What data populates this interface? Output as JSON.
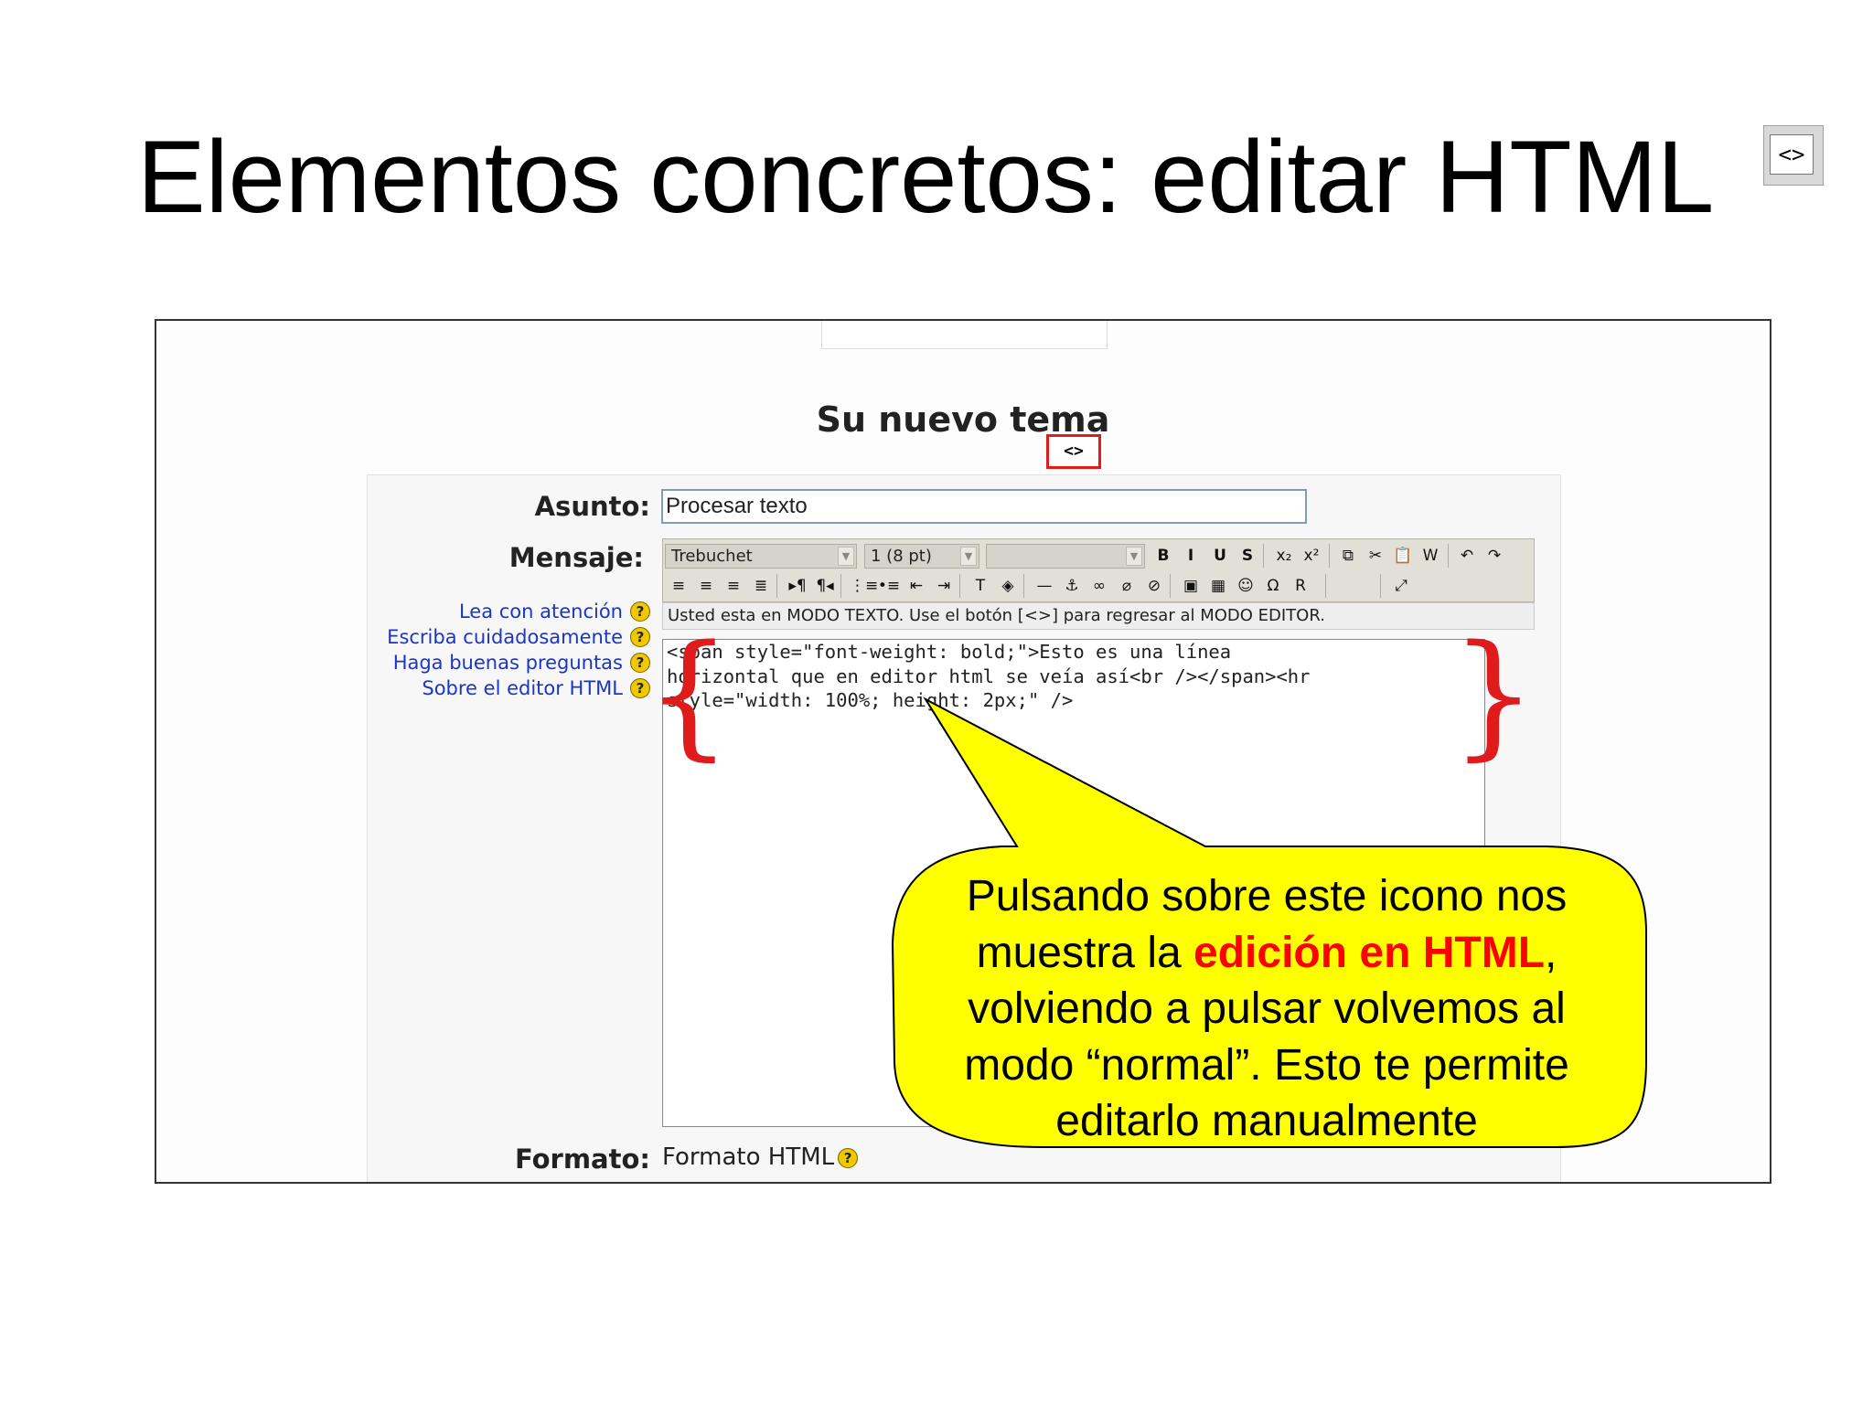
{
  "slide": {
    "title": "Elementos concretos: editar HTML",
    "title_icon": "<>"
  },
  "form": {
    "heading": "Su nuevo tema",
    "subject_label": "Asunto:",
    "subject_value": "Procesar texto",
    "message_label": "Mensaje:",
    "format_label": "Formato:",
    "format_value": "Formato HTML",
    "help_links": [
      {
        "label": "Lea con atención"
      },
      {
        "label": "Escriba cuidadosamente"
      },
      {
        "label": "Haga buenas preguntas"
      },
      {
        "label": "Sobre el editor HTML"
      }
    ]
  },
  "toolbar": {
    "font": "Trebuchet",
    "size": "1 (8 pt)",
    "style": "",
    "html_toggle": "<>",
    "row1": [
      {
        "name": "bold-button",
        "glyph": "B"
      },
      {
        "name": "italic-button",
        "glyph": "I"
      },
      {
        "name": "underline-button",
        "glyph": "U"
      },
      {
        "name": "strikethrough-button",
        "glyph": "S"
      },
      {
        "name": "subscript-button",
        "glyph": "x₂"
      },
      {
        "name": "superscript-button",
        "glyph": "x²"
      },
      {
        "name": "copy-button",
        "glyph": "⧉"
      },
      {
        "name": "cut-button",
        "glyph": "✂"
      },
      {
        "name": "paste-button",
        "glyph": "📋"
      },
      {
        "name": "paste-word-button",
        "glyph": "W"
      },
      {
        "name": "undo-button",
        "glyph": "↶"
      },
      {
        "name": "redo-button",
        "glyph": "↷"
      }
    ],
    "row2": [
      {
        "name": "align-left-button",
        "glyph": "≡"
      },
      {
        "name": "align-center-button",
        "glyph": "≡"
      },
      {
        "name": "align-right-button",
        "glyph": "≡"
      },
      {
        "name": "justify-button",
        "glyph": "≣"
      },
      {
        "name": "ltr-button",
        "glyph": "▸¶"
      },
      {
        "name": "rtl-button",
        "glyph": "¶◂"
      },
      {
        "name": "ordered-list-button",
        "glyph": "⋮≡"
      },
      {
        "name": "unordered-list-button",
        "glyph": "•≡"
      },
      {
        "name": "outdent-button",
        "glyph": "⇤"
      },
      {
        "name": "indent-button",
        "glyph": "⇥"
      },
      {
        "name": "text-color-button",
        "glyph": "T"
      },
      {
        "name": "background-color-button",
        "glyph": "◈"
      },
      {
        "name": "horizontal-rule-button",
        "glyph": "—"
      },
      {
        "name": "anchor-button",
        "glyph": "⚓"
      },
      {
        "name": "link-button",
        "glyph": "∞"
      },
      {
        "name": "unlink-button",
        "glyph": "⌀"
      },
      {
        "name": "nolink-button",
        "glyph": "⊘"
      },
      {
        "name": "image-button",
        "glyph": "▣"
      },
      {
        "name": "table-button",
        "glyph": "▦"
      },
      {
        "name": "smiley-button",
        "glyph": "☺"
      },
      {
        "name": "special-char-button",
        "glyph": "Ω"
      },
      {
        "name": "search-replace-button",
        "glyph": "R"
      },
      {
        "name": "fullscreen-button",
        "glyph": "⤢"
      }
    ]
  },
  "mode_bar": {
    "text": "Usted esta en MODO TEXTO. Use el botón [<>] para regresar al MODO EDITOR."
  },
  "editor": {
    "lines": [
      "<span style=\"font-weight: bold;\">Esto es una línea",
      "horizontal que en editor html se veía así<br /></span><hr",
      "style=\"width: 100%; height: 2px;\" />"
    ]
  },
  "callout": {
    "line1": "Pulsando sobre este icono nos",
    "line2_pre": "muestra la ",
    "line2_highlight": "edición en HTML",
    "line2_post": ",",
    "line3": "volviendo a pulsar volvemos al",
    "line4": "modo “normal”. Esto te permite",
    "line5": "editarlo manualmente",
    "fill": "#ffff00",
    "highlight_color": "#ff0000"
  }
}
